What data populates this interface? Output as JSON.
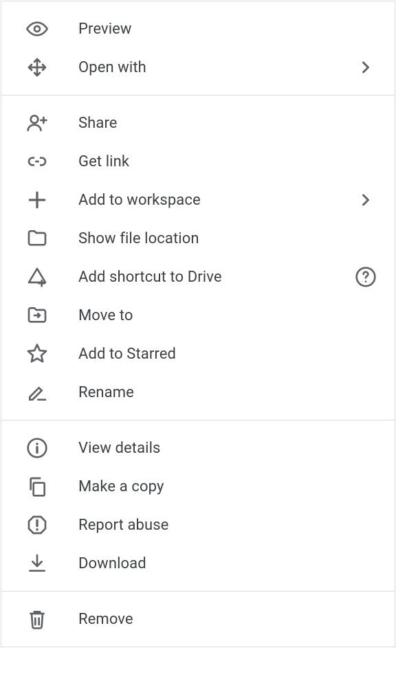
{
  "menu": {
    "sections": [
      {
        "items": [
          {
            "id": "preview",
            "label": "Preview"
          },
          {
            "id": "open-with",
            "label": "Open with",
            "has_submenu": true
          }
        ]
      },
      {
        "items": [
          {
            "id": "share",
            "label": "Share"
          },
          {
            "id": "get-link",
            "label": "Get link"
          },
          {
            "id": "add-to-workspace",
            "label": "Add to workspace",
            "has_submenu": true
          },
          {
            "id": "show-file-location",
            "label": "Show file location"
          },
          {
            "id": "add-shortcut-to-drive",
            "label": "Add shortcut to Drive",
            "has_help": true
          },
          {
            "id": "move-to",
            "label": "Move to"
          },
          {
            "id": "add-to-starred",
            "label": "Add to Starred"
          },
          {
            "id": "rename",
            "label": "Rename"
          }
        ]
      },
      {
        "items": [
          {
            "id": "view-details",
            "label": "View details"
          },
          {
            "id": "make-a-copy",
            "label": "Make a copy"
          },
          {
            "id": "report-abuse",
            "label": "Report abuse"
          },
          {
            "id": "download",
            "label": "Download"
          }
        ]
      },
      {
        "items": [
          {
            "id": "remove",
            "label": "Remove"
          }
        ]
      }
    ]
  }
}
